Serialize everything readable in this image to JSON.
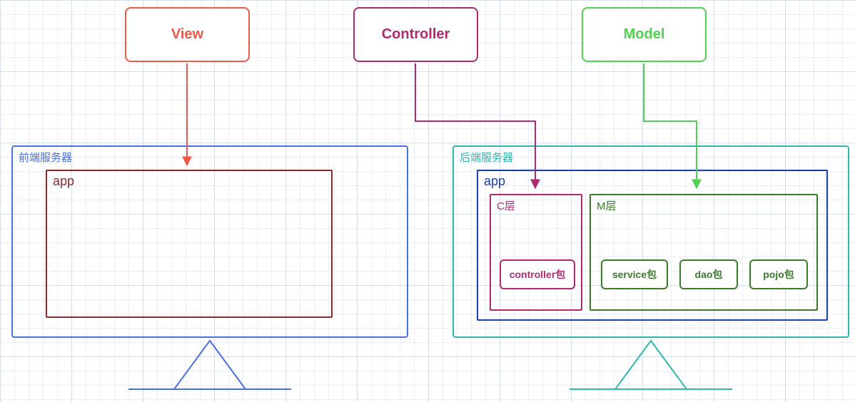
{
  "mvc": {
    "view": {
      "label": "View",
      "color": "#ef5a4b"
    },
    "controller": {
      "label": "Controller",
      "color": "#b02a6f"
    },
    "model": {
      "label": "Model",
      "color": "#4fd24f"
    }
  },
  "frontend": {
    "server_label": "前端服务器",
    "server_color": "#4a6fe0",
    "app_label": "app",
    "app_color": "#8a2a2a"
  },
  "backend": {
    "server_label": "后端服务器",
    "server_color": "#2fb8b0",
    "app_label": "app",
    "app_color": "#1a3fae",
    "c_layer": {
      "label": "C层",
      "color": "#b02a6f"
    },
    "m_layer": {
      "label": "M层",
      "color": "#3a7a2a"
    },
    "packages": {
      "controller": "controller包",
      "service": "service包",
      "dao": "dao包",
      "pojo": "pojo包"
    }
  }
}
